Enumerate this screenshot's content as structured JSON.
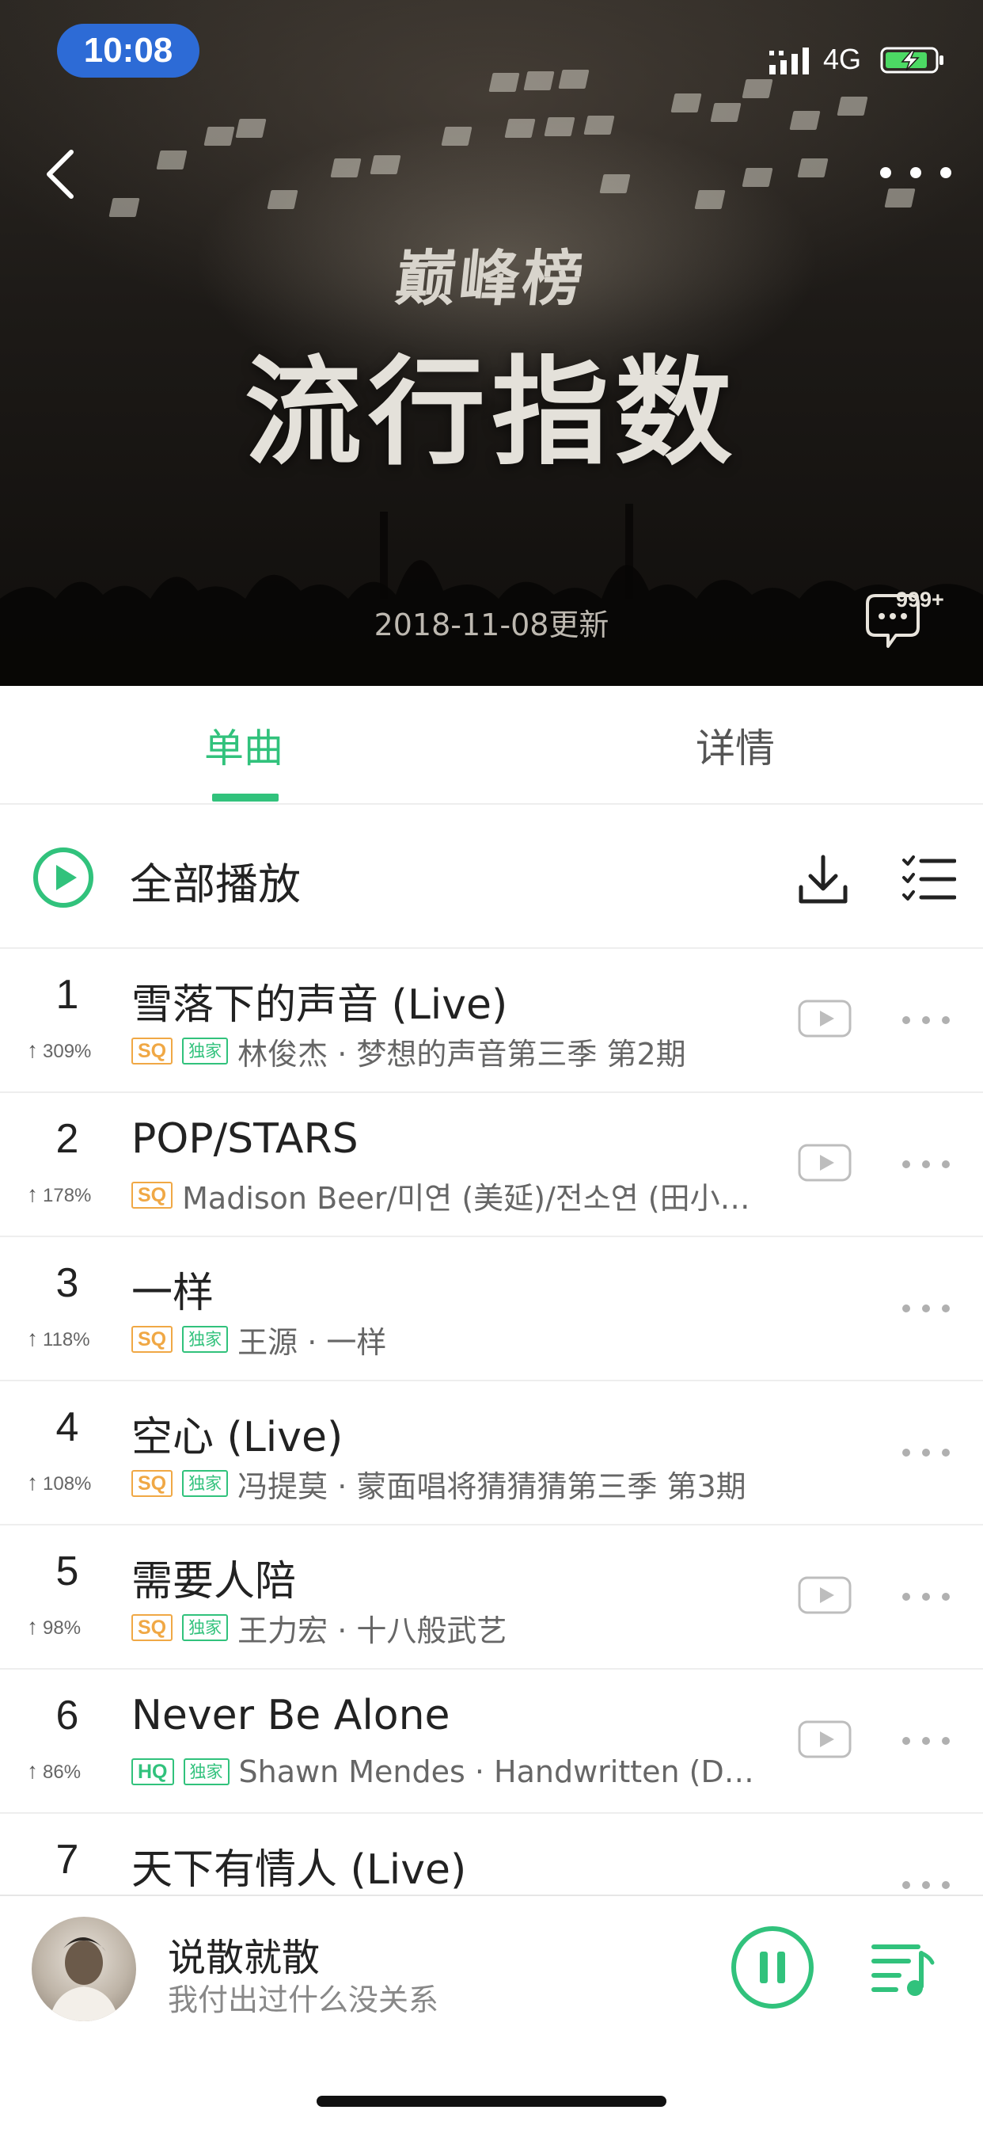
{
  "status_bar": {
    "time": "10:08",
    "network": "4G",
    "battery_state": "charging",
    "battery_level": 0.8,
    "time_pill_color": "#2d6bd6"
  },
  "header": {
    "brand": "巅峰榜",
    "title": "流行指数",
    "update_text": "2018-11-08更新",
    "comment_count": "999+"
  },
  "tabs": [
    {
      "label": "单曲",
      "active": true
    },
    {
      "label": "详情",
      "active": false
    }
  ],
  "play_all": {
    "label": "全部播放"
  },
  "songs": [
    {
      "rank": "1",
      "trend": "309%",
      "title": "雪落下的声音 (Live)",
      "badges": [
        "SQ",
        "独家"
      ],
      "meta": "林俊杰 · 梦想的声音第三季 第2期",
      "has_mv": true
    },
    {
      "rank": "2",
      "trend": "178%",
      "title": "POP/STARS",
      "badges": [
        "SQ"
      ],
      "meta": "Madison Beer/미연 (美延)/전소연 (田小…",
      "has_mv": true
    },
    {
      "rank": "3",
      "trend": "118%",
      "title": "一样",
      "badges": [
        "SQ",
        "独家"
      ],
      "meta": "王源 · 一样",
      "has_mv": false
    },
    {
      "rank": "4",
      "trend": "108%",
      "title": "空心 (Live)",
      "badges": [
        "SQ",
        "独家"
      ],
      "meta": "冯提莫 · 蒙面唱将猜猜猜第三季 第3期",
      "has_mv": false
    },
    {
      "rank": "5",
      "trend": "98%",
      "title": "需要人陪",
      "badges": [
        "SQ",
        "独家"
      ],
      "meta": "王力宏 · 十八般武艺",
      "has_mv": true
    },
    {
      "rank": "6",
      "trend": "86%",
      "title": "Never Be Alone",
      "badges": [
        "HQ",
        "独家"
      ],
      "meta": "Shawn Mendes · Handwritten (D…",
      "has_mv": true
    },
    {
      "rank": "7",
      "trend": "",
      "title": "天下有情人 (Live)",
      "badges": [],
      "meta": "",
      "has_mv": false
    }
  ],
  "now_playing": {
    "title": "说散就散",
    "subtitle": "我付出过什么没关系",
    "state": "playing"
  },
  "colors": {
    "accent": "#31c27c",
    "sq_badge": "#f0a845",
    "text_primary": "#222222",
    "text_secondary": "#666666"
  },
  "icons": {
    "back": "chevron-left-icon",
    "more": "more-horizontal-icon",
    "comment": "comment-bubble-icon",
    "play_all": "play-circle-icon",
    "download": "download-icon",
    "multiselect": "list-checklist-icon",
    "mv": "mv-play-icon",
    "pause": "pause-icon",
    "playlist": "playlist-icon"
  }
}
